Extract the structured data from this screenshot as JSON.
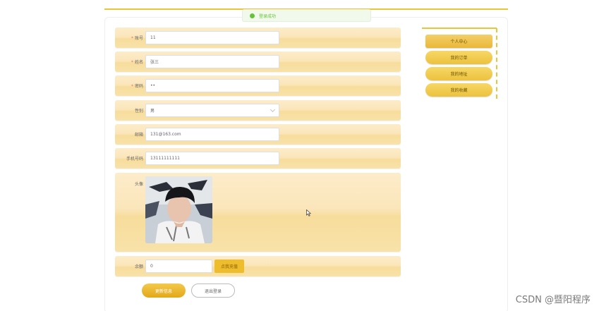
{
  "toast": {
    "message": "登录成功"
  },
  "form": {
    "account_label": "账号",
    "account_value": "11",
    "name_label": "姓名",
    "name_value": "张三",
    "password_label": "密码",
    "password_value": "••",
    "gender_label": "性别",
    "gender_value": "男",
    "email_label": "邮箱",
    "email_value": "131@163.com",
    "phone_label": "手机号码",
    "phone_value": "13111111111",
    "avatar_label": "头像",
    "balance_label": "余额",
    "balance_value": "0",
    "recharge_label": "点我充值",
    "required_mark": "*"
  },
  "actions": {
    "update_label": "更新信息",
    "logout_label": "退出登录"
  },
  "sidebar": {
    "items": [
      {
        "label": "个人中心"
      },
      {
        "label": "我的订单"
      },
      {
        "label": "我的地址"
      },
      {
        "label": "我的收藏"
      }
    ]
  },
  "watermark": {
    "text": "CSDN @暨阳程序"
  },
  "colors": {
    "accent": "#e9c53a",
    "row_bg": "#fbe6bb",
    "success": "#67c23a"
  },
  "icons": {
    "toast": "success-icon",
    "select": "chevron-down-icon",
    "cursor": "pointer-icon"
  }
}
